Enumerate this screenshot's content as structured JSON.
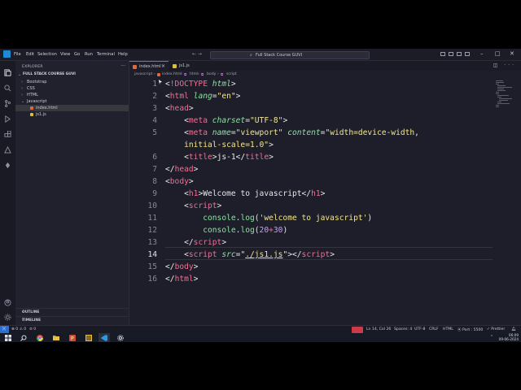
{
  "window": {
    "menu": [
      "File",
      "Edit",
      "Selection",
      "View",
      "Go",
      "Run",
      "Terminal",
      "Help"
    ],
    "command_center": "Full Stack Course GUVI"
  },
  "sidebar": {
    "title": "EXPLORER",
    "folder": "FULL STACK COURSE GUVI",
    "tree": [
      {
        "label": "Bootstrap",
        "type": "folder",
        "expanded": false
      },
      {
        "label": "CSS",
        "type": "folder",
        "expanded": false
      },
      {
        "label": "HTML",
        "type": "folder",
        "expanded": false
      },
      {
        "label": "Javascript",
        "type": "folder",
        "expanded": true
      },
      {
        "label": "index.html",
        "type": "file",
        "selected": true
      },
      {
        "label": "js1.js",
        "type": "file",
        "selected": false
      }
    ],
    "outline": "OUTLINE",
    "timeline": "TIMELINE"
  },
  "tabs": [
    {
      "label": "index.html",
      "active": true
    },
    {
      "label": "js1.js",
      "active": false
    }
  ],
  "breadcrumb": [
    "javascript",
    "index.html",
    "html",
    "body",
    "script"
  ],
  "editor": {
    "current_line": 14,
    "line_numbers": [
      "1",
      "2",
      "3",
      "4",
      "5",
      "",
      "6",
      "7",
      "8",
      "9",
      "10",
      "11",
      "12",
      "13",
      "14",
      "15",
      "16"
    ]
  },
  "code_tokens": {
    "l1_doctype": "!DOCTYPE",
    "l1_html": "html",
    "l2_tag": "html",
    "l2_attr": "lang",
    "l2_val": "\"en\"",
    "l3_tag": "head",
    "l4_tag": "meta",
    "l4_attr": "charset",
    "l4_val": "\"UTF-8\"",
    "l5_tag": "meta",
    "l5_attr1": "name",
    "l5_val1": "\"viewport\"",
    "l5_attr2": "content",
    "l5_val2a": "\"width=device-width,",
    "l5_val2b": "initial-scale=1.0\"",
    "l6_tag": "title",
    "l6_text": "js-1",
    "l6_tag2": "title",
    "l7_tag": "head",
    "l8_tag": "body",
    "l9_tag": "h1",
    "l9_text": "Welcome to javascript",
    "l9_tag2": "h1",
    "l10_tag": "script",
    "l11_fn": "console",
    "l11_method": "log",
    "l11_str": "'welcome to javascript'",
    "l12_fn": "console",
    "l12_method": "log",
    "l12_num1": "20",
    "l12_num2": "30",
    "l13_tag": "script",
    "l14_tag": "script",
    "l14_attr": "src",
    "l14_val": "./js1.js",
    "l14_tag2": "script",
    "l15_tag": "body",
    "l16_tag": "html"
  },
  "statusbar": {
    "problems": "⊗ 0 ⚠ 0",
    "sync": "⊘ 0",
    "position": "Ln 14, Col 26",
    "spaces": "Spaces: 4",
    "encoding": "UTF-8",
    "eol": "CRLF",
    "language": "HTML",
    "port": "⦿ Port : 5500",
    "prettier": "✓ Prettier"
  },
  "taskbar": {
    "time": "06:09",
    "date": "09-06-2024"
  },
  "colors": {
    "tag": "#ef6f93",
    "attr": "#8ce0a0",
    "string": "#f2e68a",
    "number": "#c6a0f0",
    "background": "#1e1e2a",
    "accent": "#2b6fd0"
  }
}
